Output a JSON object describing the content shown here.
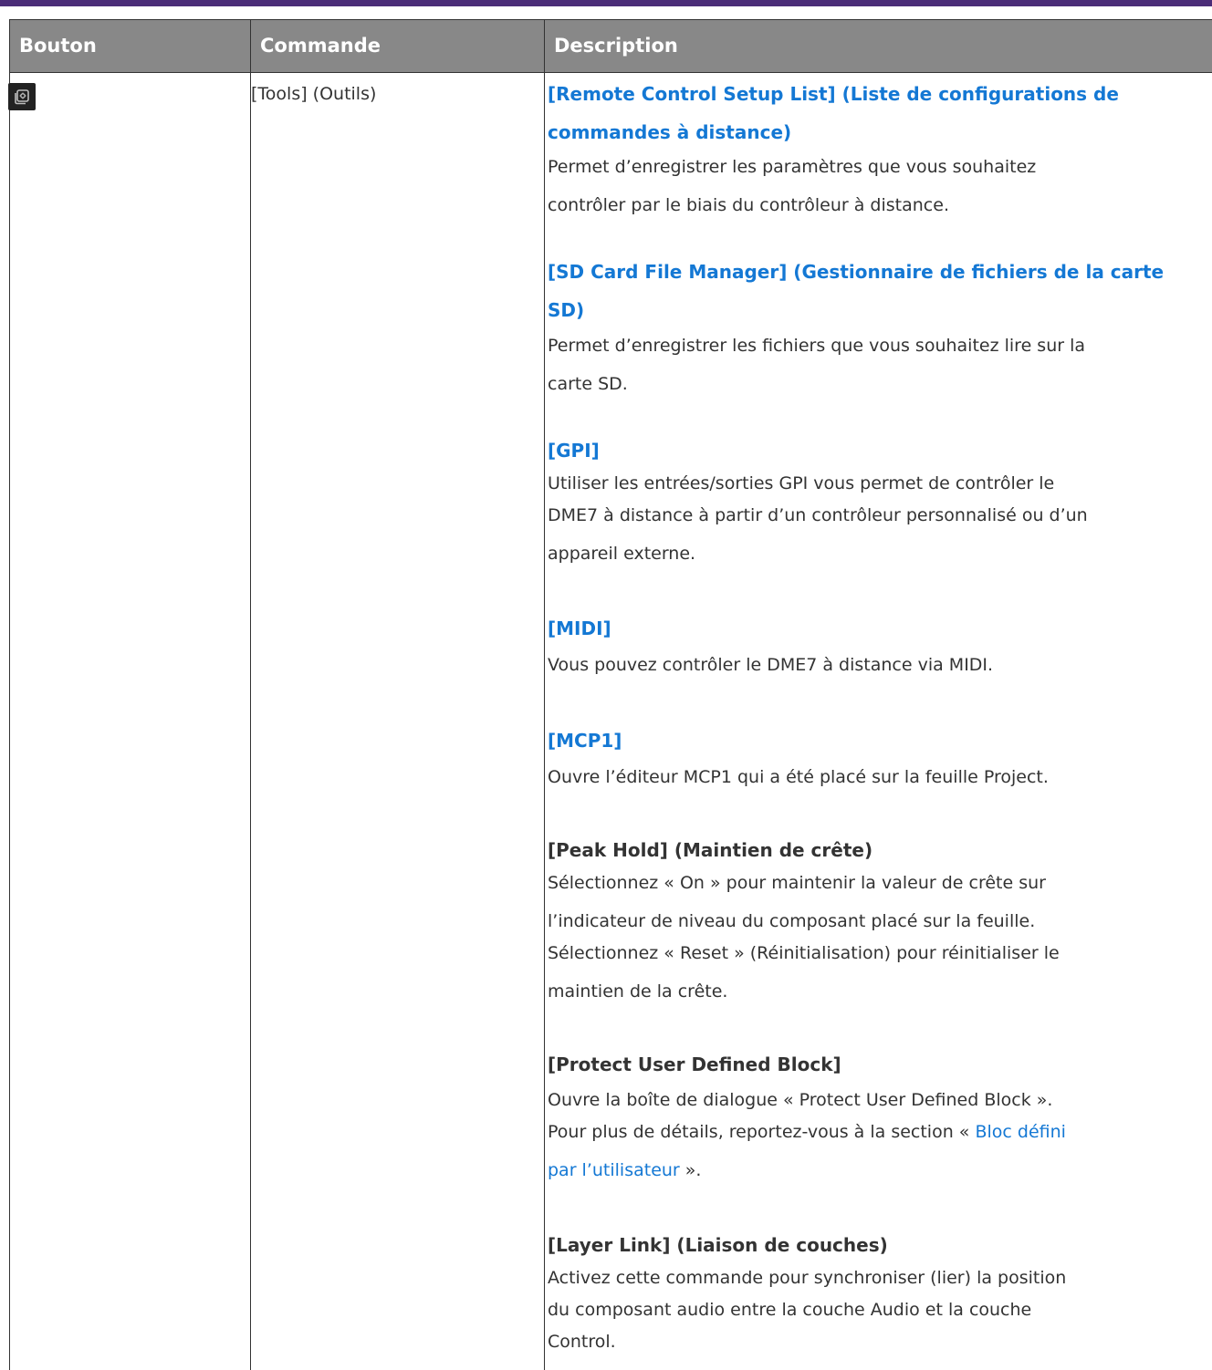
{
  "table": {
    "headers": {
      "bouton": "Bouton",
      "commande": "Commande",
      "description": "Description"
    },
    "row": {
      "icon": "tools-icon",
      "command": "[Tools] (Outils)",
      "sections": {
        "remote": {
          "title_l1": "[Remote Control Setup List] (Liste de configurations de",
          "title_l2": "commandes à distance)",
          "text_l1": "Permet d’enregistrer les paramètres que vous souhaitez",
          "text_l2": "contrôler par le biais du contrôleur à distance."
        },
        "sdcard": {
          "title_l1": "[SD Card File Manager] (Gestionnaire de fichiers de la carte",
          "title_l2": "SD)",
          "text_l1": "Permet d’enregistrer les fichiers que vous souhaitez lire sur la",
          "text_l2": "carte SD."
        },
        "gpi": {
          "title": "[GPI]",
          "text_l1": "Utiliser les entrées/sorties GPI vous permet de contrôler le",
          "text_l2": "DME7 à distance à partir d’un contrôleur personnalisé ou d’un",
          "text_l3": "appareil externe."
        },
        "midi": {
          "title": "[MIDI]",
          "text_l1": "Vous pouvez contrôler le DME7 à distance via MIDI."
        },
        "mcp1": {
          "title": "[MCP1]",
          "text_l1": "Ouvre l’éditeur MCP1 qui a été placé sur la feuille Project."
        },
        "peak": {
          "title": "[Peak Hold] (Maintien de crête)",
          "text_l1": "Sélectionnez « On » pour maintenir la valeur de crête sur",
          "text_l2": "l’indicateur de niveau du composant placé sur la feuille.",
          "text_l3": "Sélectionnez « Reset » (Réinitialisation) pour réinitialiser le",
          "text_l4": "maintien de la crête."
        },
        "protect": {
          "title": "[Protect User Defined Block]",
          "text_l1": "Ouvre la boîte de dialogue « Protect User Defined Block ».",
          "text_l2_pre": "Pour plus de détails, reportez-vous à la section « ",
          "text_l2_link": "Bloc défini",
          "text_l3_link": "par l’utilisateur",
          "text_l3_post": " »."
        },
        "layer": {
          "title": "[Layer Link] (Liaison de couches)",
          "text_l1": "Activez cette commande pour synchroniser (lier) la position",
          "text_l2": "du composant audio entre la couche Audio et la couche",
          "text_l3": "Control."
        }
      }
    }
  },
  "colors": {
    "header_bg": "#888888",
    "top_rule": "#4b2d78",
    "link": "#1478d4"
  }
}
